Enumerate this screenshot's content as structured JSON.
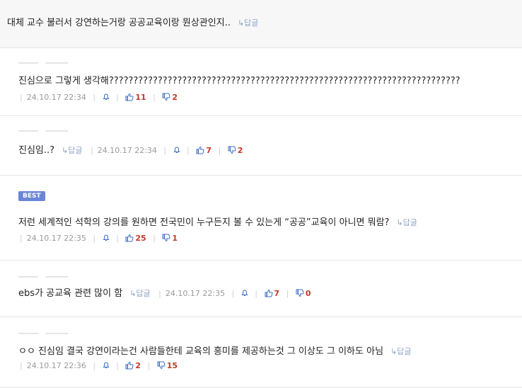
{
  "reply_label": "↳답글",
  "comments": [
    {
      "text": "대체 교수 불러서 강연하는거랑 공공교육이랑 뭔상관인지..",
      "reply": "↳답글"
    },
    {
      "text": "진심으로 그렇게 생각해????????????????????????????????????????????????????????????????????????",
      "date": "24.10.17 22:34",
      "up": "11",
      "down": "2"
    },
    {
      "text": "진심임..?",
      "reply": "↳답글",
      "date": "24.10.17 22:34",
      "up": "7",
      "down": "2"
    },
    {
      "badge": "BEST",
      "text": "저런 세계적인 석학의 강의를 원하면 전국민이 누구든지 볼 수 있는게 “공공”교육이 아니면 뭐람?",
      "reply": "↳답글",
      "date": "24.10.17 22:35",
      "up": "25",
      "down": "1"
    },
    {
      "text": "ebs가 공교육 관련 많이 함",
      "reply": "↳답글",
      "date": "24.10.17 22:35",
      "up": "7",
      "down": "0"
    },
    {
      "text": "ㅇㅇ 진심임 결국 강연이라는건 사람들한테 교육의 흥미를 제공하는것 그 이상도 그 이하도 아님",
      "reply": "↳답글",
      "date": "24.10.17 22:36",
      "up": "2",
      "down": "15"
    }
  ],
  "colors": {
    "reply": "#8da3c7",
    "best_badge": "#6a86d8",
    "count": "#c0392b",
    "thumb": "#3d6fc4"
  },
  "icons": [
    "bell-icon",
    "thumbs-up-icon",
    "thumbs-down-icon"
  ]
}
